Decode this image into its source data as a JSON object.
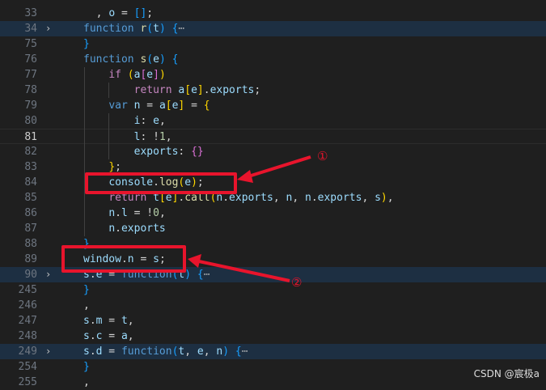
{
  "lines": [
    {
      "num": "33",
      "tokens": [
        {
          "t": "  , ",
          "c": "p"
        },
        {
          "t": "o",
          "c": "v"
        },
        {
          "t": " = ",
          "c": "p"
        },
        {
          "t": "[]",
          "c": "b3"
        },
        {
          "t": ";",
          "c": "p"
        }
      ]
    },
    {
      "num": "34",
      "fold": true,
      "tokens": [
        {
          "t": "function ",
          "c": "k"
        },
        {
          "t": "r",
          "c": "fn"
        },
        {
          "t": "(",
          "c": "b3"
        },
        {
          "t": "t",
          "c": "v"
        },
        {
          "t": ")",
          "c": "b3"
        },
        {
          "t": " ",
          "c": "p"
        },
        {
          "t": "{",
          "c": "b3"
        },
        {
          "t": "⋯",
          "c": "ell"
        }
      ]
    },
    {
      "num": "75",
      "tokens": [
        {
          "t": "}",
          "c": "b3"
        }
      ]
    },
    {
      "num": "76",
      "tokens": [
        {
          "t": "function ",
          "c": "k"
        },
        {
          "t": "s",
          "c": "fn"
        },
        {
          "t": "(",
          "c": "b3"
        },
        {
          "t": "e",
          "c": "v"
        },
        {
          "t": ")",
          "c": "b3"
        },
        {
          "t": " ",
          "c": "p"
        },
        {
          "t": "{",
          "c": "b3"
        }
      ]
    },
    {
      "num": "77",
      "tokens": [
        {
          "t": "    ",
          "c": "p"
        },
        {
          "t": "if ",
          "c": "cf"
        },
        {
          "t": "(",
          "c": "b1"
        },
        {
          "t": "a",
          "c": "v"
        },
        {
          "t": "[",
          "c": "b2"
        },
        {
          "t": "e",
          "c": "v"
        },
        {
          "t": "]",
          "c": "b2"
        },
        {
          "t": ")",
          "c": "b1"
        }
      ]
    },
    {
      "num": "78",
      "tokens": [
        {
          "t": "        ",
          "c": "p"
        },
        {
          "t": "return ",
          "c": "cf"
        },
        {
          "t": "a",
          "c": "v"
        },
        {
          "t": "[",
          "c": "b1"
        },
        {
          "t": "e",
          "c": "v"
        },
        {
          "t": "]",
          "c": "b1"
        },
        {
          "t": ".",
          "c": "p"
        },
        {
          "t": "exports",
          "c": "v"
        },
        {
          "t": ";",
          "c": "p"
        }
      ]
    },
    {
      "num": "79",
      "tokens": [
        {
          "t": "    ",
          "c": "p"
        },
        {
          "t": "var ",
          "c": "k"
        },
        {
          "t": "n",
          "c": "v"
        },
        {
          "t": " = ",
          "c": "p"
        },
        {
          "t": "a",
          "c": "v"
        },
        {
          "t": "[",
          "c": "b1"
        },
        {
          "t": "e",
          "c": "v"
        },
        {
          "t": "]",
          "c": "b1"
        },
        {
          "t": " = ",
          "c": "p"
        },
        {
          "t": "{",
          "c": "b1"
        }
      ]
    },
    {
      "num": "80",
      "tokens": [
        {
          "t": "        ",
          "c": "p"
        },
        {
          "t": "i",
          "c": "v"
        },
        {
          "t": ": ",
          "c": "p"
        },
        {
          "t": "e",
          "c": "v"
        },
        {
          "t": ",",
          "c": "p"
        }
      ]
    },
    {
      "num": "81",
      "active": true,
      "tokens": [
        {
          "t": "        ",
          "c": "p"
        },
        {
          "t": "l",
          "c": "v"
        },
        {
          "t": ": !",
          "c": "p"
        },
        {
          "t": "1",
          "c": "n"
        },
        {
          "t": ",",
          "c": "p"
        }
      ]
    },
    {
      "num": "82",
      "tokens": [
        {
          "t": "        ",
          "c": "p"
        },
        {
          "t": "exports",
          "c": "v"
        },
        {
          "t": ": ",
          "c": "p"
        },
        {
          "t": "{}",
          "c": "b2"
        }
      ]
    },
    {
      "num": "83",
      "tokens": [
        {
          "t": "    ",
          "c": "p"
        },
        {
          "t": "}",
          "c": "b1"
        },
        {
          "t": ";",
          "c": "p"
        }
      ]
    },
    {
      "num": "84",
      "tokens": [
        {
          "t": "    ",
          "c": "p"
        },
        {
          "t": "console",
          "c": "v"
        },
        {
          "t": ".",
          "c": "p"
        },
        {
          "t": "log",
          "c": "fn"
        },
        {
          "t": "(",
          "c": "b1"
        },
        {
          "t": "e",
          "c": "v"
        },
        {
          "t": ")",
          "c": "b1"
        },
        {
          "t": ";",
          "c": "p"
        }
      ]
    },
    {
      "num": "85",
      "tokens": [
        {
          "t": "    ",
          "c": "p"
        },
        {
          "t": "return ",
          "c": "cf"
        },
        {
          "t": "t",
          "c": "v"
        },
        {
          "t": "[",
          "c": "b1"
        },
        {
          "t": "e",
          "c": "v"
        },
        {
          "t": "]",
          "c": "b1"
        },
        {
          "t": ".",
          "c": "p"
        },
        {
          "t": "call",
          "c": "fn"
        },
        {
          "t": "(",
          "c": "b1"
        },
        {
          "t": "n",
          "c": "v"
        },
        {
          "t": ".",
          "c": "p"
        },
        {
          "t": "exports",
          "c": "v"
        },
        {
          "t": ", ",
          "c": "p"
        },
        {
          "t": "n",
          "c": "v"
        },
        {
          "t": ", ",
          "c": "p"
        },
        {
          "t": "n",
          "c": "v"
        },
        {
          "t": ".",
          "c": "p"
        },
        {
          "t": "exports",
          "c": "v"
        },
        {
          "t": ", ",
          "c": "p"
        },
        {
          "t": "s",
          "c": "v"
        },
        {
          "t": ")",
          "c": "b1"
        },
        {
          "t": ",",
          "c": "p"
        }
      ]
    },
    {
      "num": "86",
      "tokens": [
        {
          "t": "    ",
          "c": "p"
        },
        {
          "t": "n",
          "c": "v"
        },
        {
          "t": ".",
          "c": "p"
        },
        {
          "t": "l",
          "c": "v"
        },
        {
          "t": " = !",
          "c": "p"
        },
        {
          "t": "0",
          "c": "n"
        },
        {
          "t": ",",
          "c": "p"
        }
      ]
    },
    {
      "num": "87",
      "tokens": [
        {
          "t": "    ",
          "c": "p"
        },
        {
          "t": "n",
          "c": "v"
        },
        {
          "t": ".",
          "c": "p"
        },
        {
          "t": "exports",
          "c": "v"
        }
      ]
    },
    {
      "num": "88",
      "tokens": [
        {
          "t": "}",
          "c": "b3"
        }
      ]
    },
    {
      "num": "89",
      "tokens": [
        {
          "t": "window",
          "c": "v"
        },
        {
          "t": ".",
          "c": "p"
        },
        {
          "t": "n",
          "c": "v"
        },
        {
          "t": " = ",
          "c": "p"
        },
        {
          "t": "s",
          "c": "v"
        },
        {
          "t": ";",
          "c": "p"
        }
      ]
    },
    {
      "num": "90",
      "fold": true,
      "tokens": [
        {
          "t": "s",
          "c": "v"
        },
        {
          "t": ".",
          "c": "p"
        },
        {
          "t": "e",
          "c": "v"
        },
        {
          "t": " = ",
          "c": "p"
        },
        {
          "t": "function",
          "c": "k"
        },
        {
          "t": "(",
          "c": "b3"
        },
        {
          "t": "t",
          "c": "v"
        },
        {
          "t": ")",
          "c": "b3"
        },
        {
          "t": " ",
          "c": "p"
        },
        {
          "t": "{",
          "c": "b3"
        },
        {
          "t": "⋯",
          "c": "ell"
        }
      ]
    },
    {
      "num": "245",
      "tokens": [
        {
          "t": "}",
          "c": "b3"
        }
      ]
    },
    {
      "num": "246",
      "tokens": [
        {
          "t": ",",
          "c": "p"
        }
      ]
    },
    {
      "num": "247",
      "tokens": [
        {
          "t": "s",
          "c": "v"
        },
        {
          "t": ".",
          "c": "p"
        },
        {
          "t": "m",
          "c": "v"
        },
        {
          "t": " = ",
          "c": "p"
        },
        {
          "t": "t",
          "c": "v"
        },
        {
          "t": ",",
          "c": "p"
        }
      ]
    },
    {
      "num": "248",
      "tokens": [
        {
          "t": "s",
          "c": "v"
        },
        {
          "t": ".",
          "c": "p"
        },
        {
          "t": "c",
          "c": "v"
        },
        {
          "t": " = ",
          "c": "p"
        },
        {
          "t": "a",
          "c": "v"
        },
        {
          "t": ",",
          "c": "p"
        }
      ]
    },
    {
      "num": "249",
      "fold": true,
      "tokens": [
        {
          "t": "s",
          "c": "v"
        },
        {
          "t": ".",
          "c": "p"
        },
        {
          "t": "d",
          "c": "v"
        },
        {
          "t": " = ",
          "c": "p"
        },
        {
          "t": "function",
          "c": "k"
        },
        {
          "t": "(",
          "c": "b3"
        },
        {
          "t": "t",
          "c": "v"
        },
        {
          "t": ", ",
          "c": "p"
        },
        {
          "t": "e",
          "c": "v"
        },
        {
          "t": ", ",
          "c": "p"
        },
        {
          "t": "n",
          "c": "v"
        },
        {
          "t": ")",
          "c": "b3"
        },
        {
          "t": " ",
          "c": "p"
        },
        {
          "t": "{",
          "c": "b3"
        },
        {
          "t": "⋯",
          "c": "ell"
        }
      ]
    },
    {
      "num": "254",
      "tokens": [
        {
          "t": "}",
          "c": "b3"
        }
      ]
    },
    {
      "num": "255",
      "tokens": [
        {
          "t": ",",
          "c": "p"
        }
      ]
    }
  ],
  "annotations": {
    "label1": "①",
    "label2": "②"
  },
  "watermark": "CSDN @宸极a",
  "colors": {
    "annotation_red": "#e8142c",
    "editor_bg": "#1f1f1f"
  }
}
